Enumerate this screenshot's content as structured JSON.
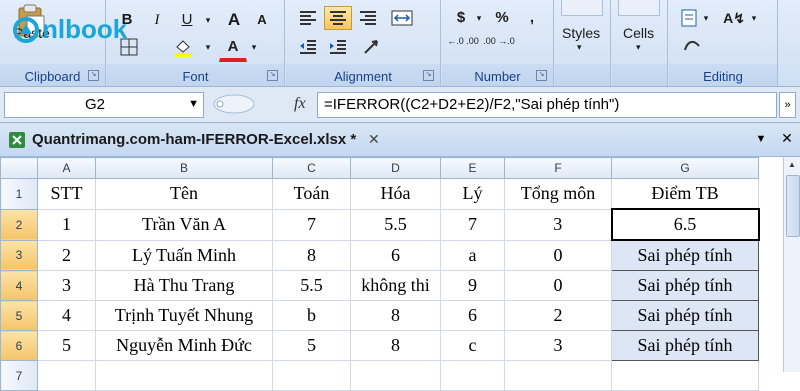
{
  "ribbon": {
    "clipboard": {
      "paste_label": "Paste",
      "group_label": "Clipboard"
    },
    "font": {
      "bold": "B",
      "italic": "I",
      "underline": "U",
      "grow": "A",
      "shrink": "A",
      "group_label": "Font"
    },
    "alignment": {
      "group_label": "Alignment"
    },
    "number": {
      "currency": "$",
      "percent": "%",
      "comma": ",",
      "inc_decimal": "←.0 .00",
      "dec_decimal": ".00 →.0",
      "group_label": "Number"
    },
    "styles": {
      "label": "Styles"
    },
    "cells": {
      "label": "Cells"
    },
    "editing": {
      "group_label": "Editing"
    }
  },
  "watermark": {
    "text": "nlbook"
  },
  "formula_bar": {
    "name_box": "G2",
    "fx": "fx",
    "formula": "=IFERROR((C2+D2+E2)/F2,\"Sai phép tính\")"
  },
  "workbook": {
    "title": "Quantrimang.com-ham-IFERROR-Excel.xlsx *",
    "close": "✕"
  },
  "sheet": {
    "columns": [
      "A",
      "B",
      "C",
      "D",
      "E",
      "F",
      "G"
    ],
    "rows": [
      {
        "n": "1",
        "cells": [
          "STT",
          "Tên",
          "Toán",
          "Hóa",
          "Lý",
          "Tổng môn",
          "Điểm TB"
        ]
      },
      {
        "n": "2",
        "cells": [
          "1",
          "Trần Văn A",
          "7",
          "5.5",
          "7",
          "3",
          "6.5"
        ]
      },
      {
        "n": "3",
        "cells": [
          "2",
          "Lý Tuấn Minh",
          "8",
          "6",
          "a",
          "0",
          "Sai phép tính"
        ]
      },
      {
        "n": "4",
        "cells": [
          "3",
          "Hà Thu Trang",
          "5.5",
          "không thi",
          "9",
          "0",
          "Sai phép tính"
        ]
      },
      {
        "n": "5",
        "cells": [
          "4",
          "Trịnh Tuyết Nhung",
          "b",
          "8",
          "6",
          "2",
          "Sai phép tính"
        ]
      },
      {
        "n": "6",
        "cells": [
          "5",
          "Nguyễn Minh Đức",
          "5",
          "8",
          "c",
          "3",
          "Sai phép tính"
        ]
      },
      {
        "n": "7",
        "cells": [
          "",
          "",
          "",
          "",
          "",
          "",
          ""
        ]
      }
    ]
  },
  "colors": {
    "accent": "#15428b",
    "selection": "#f9c55e"
  }
}
